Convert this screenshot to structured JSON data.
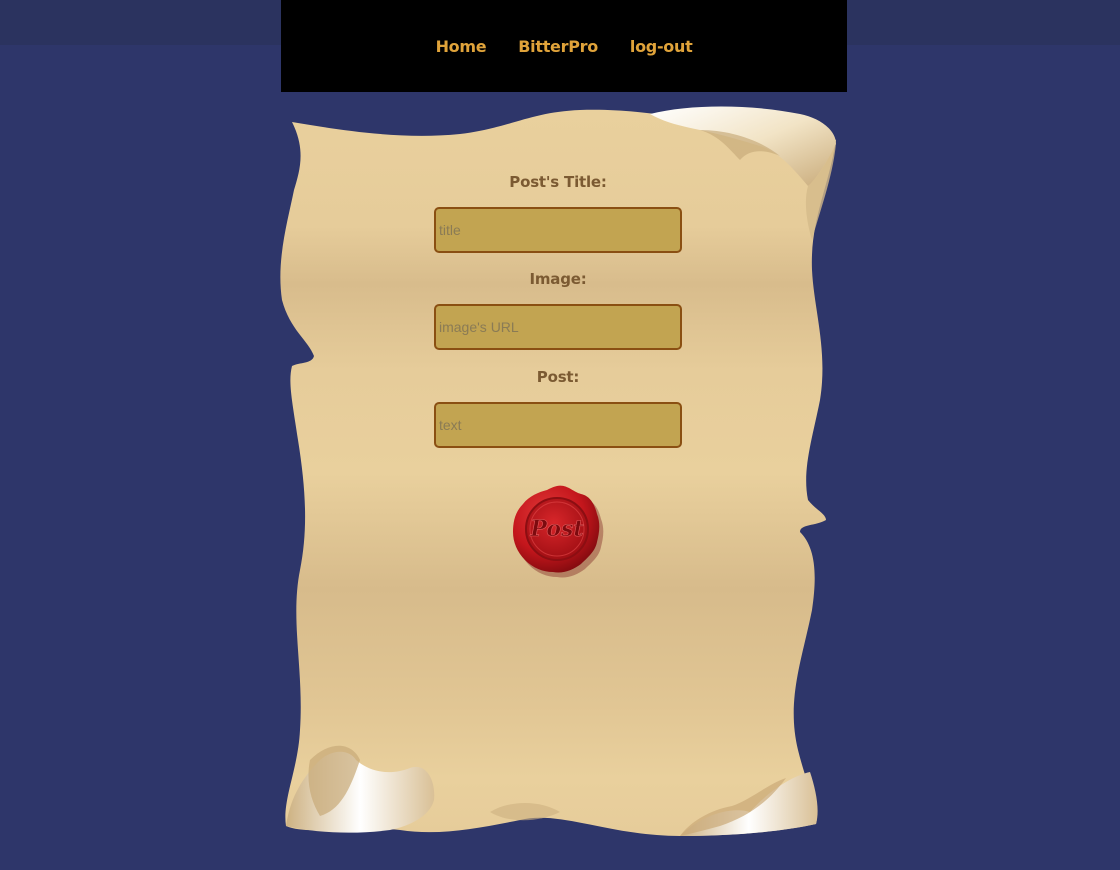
{
  "nav": {
    "home": "Home",
    "brand": "BitterPro",
    "logout": "log-out"
  },
  "form": {
    "title_label": "Post's Title:",
    "title_placeholder": "title",
    "image_label": "Image:",
    "image_placeholder": "image's URL",
    "post_label": "Post:",
    "post_placeholder": "text",
    "submit_label": "Post"
  },
  "colors": {
    "page_background": "#2e366a",
    "nav_background": "#000000",
    "nav_link": "#e0a33a",
    "parchment": "#e8cf9c",
    "field_fill": "#c2a451",
    "field_border": "#8a4f12",
    "seal_red": "#c4161c"
  },
  "icons": {
    "scroll": "parchment-scroll-icon",
    "seal": "wax-seal-icon"
  }
}
